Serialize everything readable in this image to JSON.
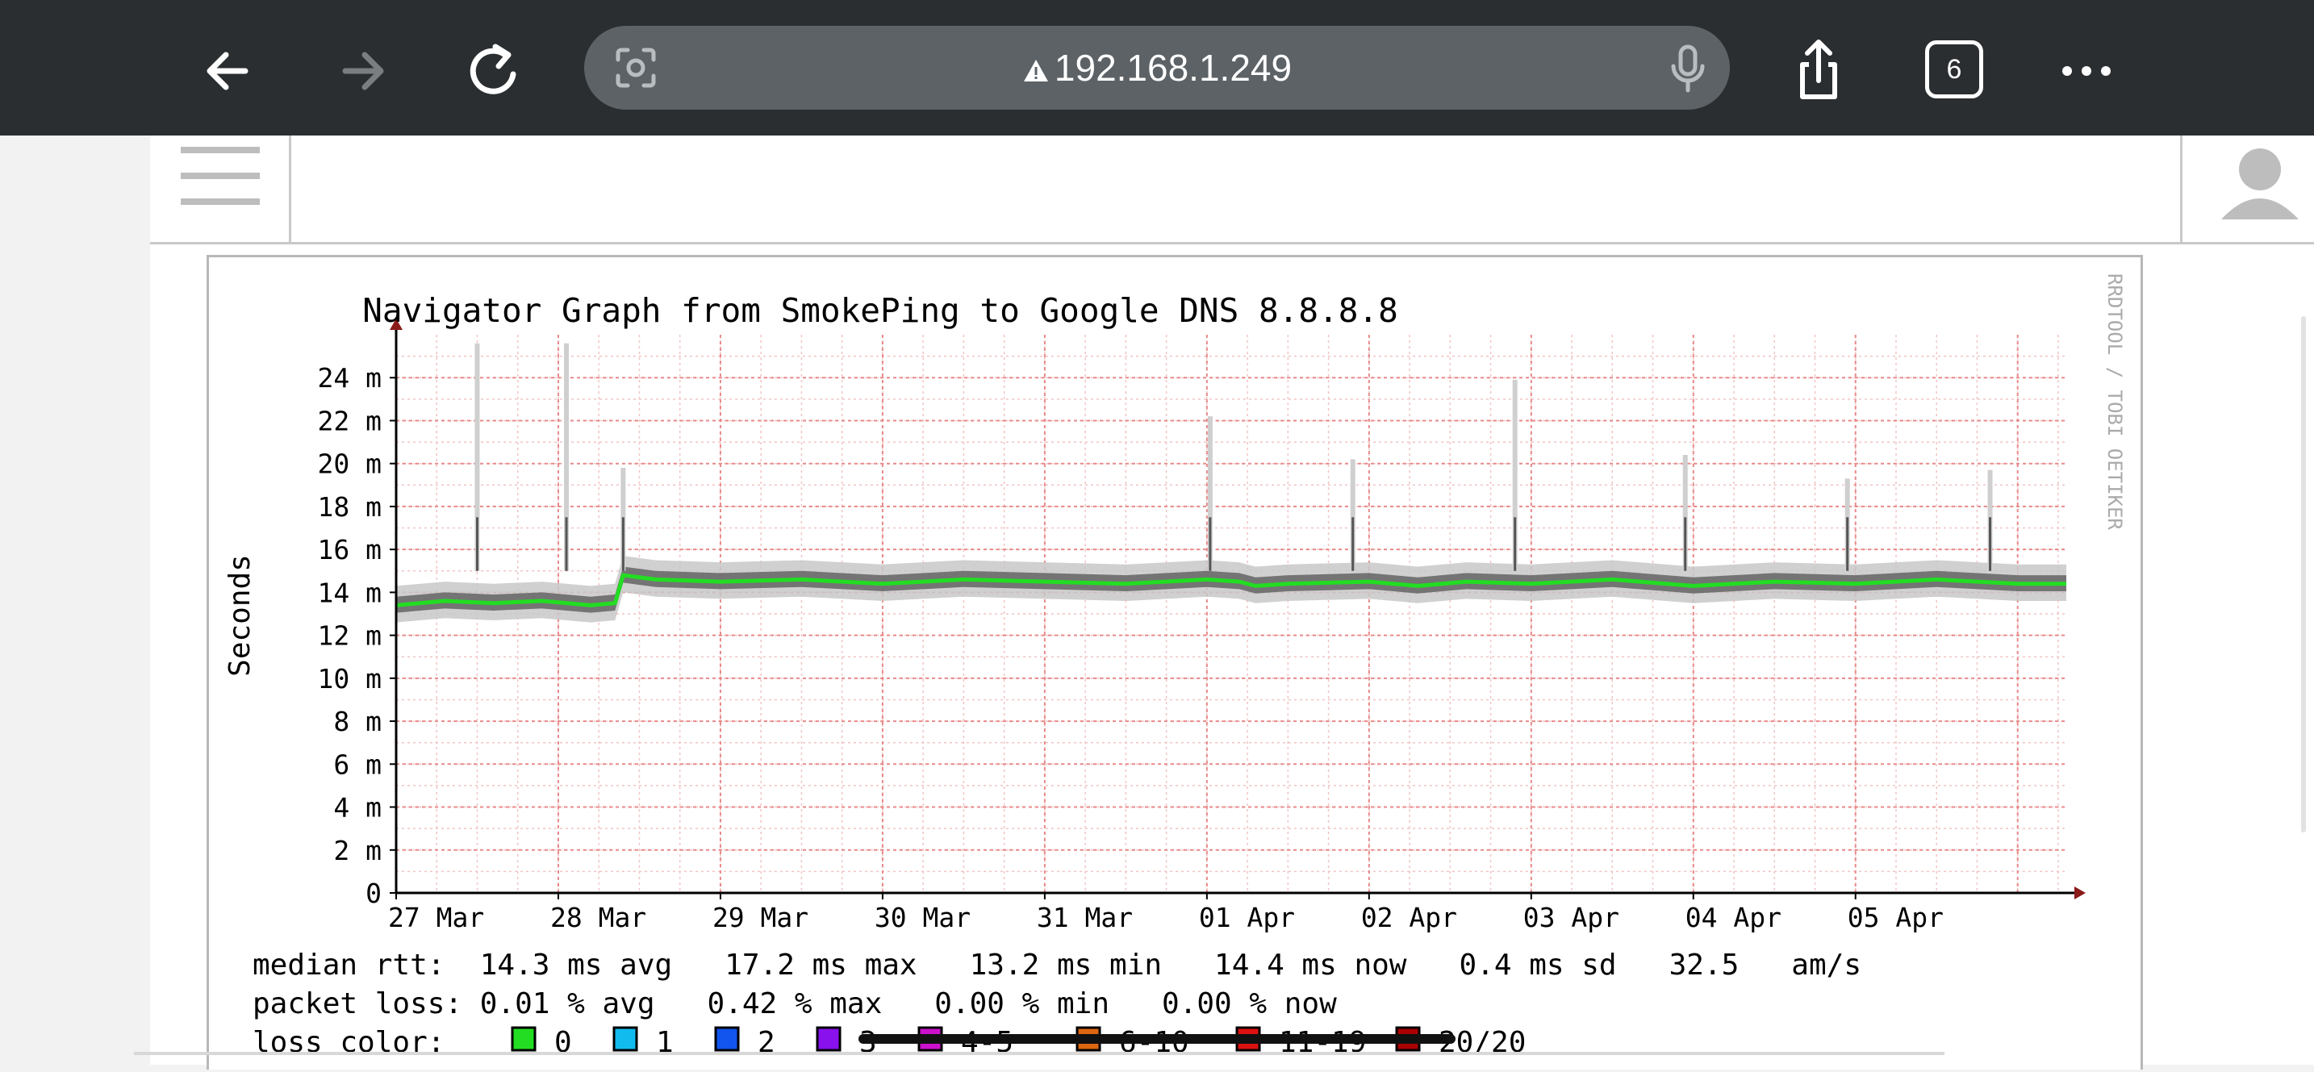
{
  "browser": {
    "url": "192.168.1.249",
    "tab_count": "6",
    "icons": [
      "back-arrow-icon",
      "forward-arrow-icon",
      "reload-icon",
      "page-lens-icon",
      "warning-icon",
      "microphone-icon",
      "share-icon",
      "tabs-icon",
      "more-icon"
    ]
  },
  "page": {
    "icons": [
      "hamburger-menu-icon",
      "user-avatar-icon"
    ]
  },
  "graph": {
    "watermark": "RRDTOOL / TOBI OETIKER",
    "stats": [
      "median rtt:  14.3 ms avg   17.2 ms max   13.2 ms min   14.4 ms now   0.4 ms sd   32.5   am/s",
      "packet loss: 0.01 % avg   0.42 % max   0.00 % min   0.00 % now"
    ],
    "legend_label": "loss color:",
    "legend": [
      {
        "label": "0",
        "color": "#22dd22"
      },
      {
        "label": "1",
        "color": "#11bbee"
      },
      {
        "label": "2",
        "color": "#1155ee"
      },
      {
        "label": "3",
        "color": "#8811ee"
      },
      {
        "label": "4-5",
        "color": "#cc11cc"
      },
      {
        "label": "6-10",
        "color": "#dd6611"
      },
      {
        "label": "11-19",
        "color": "#dd1111"
      },
      {
        "label": "20/20",
        "color": "#aa0000"
      }
    ]
  },
  "chart_data": {
    "type": "line",
    "title": "Navigator Graph from SmokePing to Google DNS 8.8.8.8",
    "ylabel": "Seconds",
    "xlabel": "",
    "ylim": [
      0,
      26
    ],
    "yticks": [
      0,
      2,
      4,
      6,
      8,
      10,
      12,
      14,
      16,
      18,
      20,
      22,
      24
    ],
    "ytick_labels": [
      "0",
      "2 m",
      "4 m",
      "6 m",
      "8 m",
      "10 m",
      "12 m",
      "14 m",
      "16 m",
      "18 m",
      "20 m",
      "22 m",
      "24 m"
    ],
    "xticks": [
      "27 Mar",
      "28 Mar",
      "29 Mar",
      "30 Mar",
      "31 Mar",
      "01 Apr",
      "02 Apr",
      "03 Apr",
      "04 Apr",
      "05 Apr"
    ],
    "xlim_days": [
      0,
      10.3
    ],
    "grid": true,
    "series": [
      {
        "name": "median rtt",
        "color": "#22dd22",
        "x": [
          0,
          0.3,
          0.6,
          0.9,
          1.2,
          1.35,
          1.4,
          1.6,
          2.0,
          2.5,
          3.0,
          3.5,
          4.0,
          4.5,
          5.0,
          5.2,
          5.3,
          5.5,
          6.0,
          6.15,
          6.3,
          6.6,
          7.0,
          7.5,
          8.0,
          8.5,
          9.0,
          9.5,
          10.0,
          10.3
        ],
        "y": [
          13.4,
          13.6,
          13.5,
          13.6,
          13.4,
          13.5,
          14.8,
          14.6,
          14.5,
          14.6,
          14.4,
          14.6,
          14.5,
          14.4,
          14.6,
          14.5,
          14.3,
          14.4,
          14.5,
          14.4,
          14.3,
          14.5,
          14.4,
          14.6,
          14.3,
          14.5,
          14.4,
          14.6,
          14.4,
          14.4
        ]
      }
    ],
    "spikes": [
      {
        "x": 0.5,
        "y": 25.6
      },
      {
        "x": 1.05,
        "y": 25.6
      },
      {
        "x": 1.4,
        "y": 19.8
      },
      {
        "x": 5.02,
        "y": 22.2
      },
      {
        "x": 5.9,
        "y": 20.2
      },
      {
        "x": 6.9,
        "y": 23.9
      },
      {
        "x": 7.95,
        "y": 20.4
      },
      {
        "x": 8.95,
        "y": 19.3
      },
      {
        "x": 9.83,
        "y": 19.7
      }
    ]
  }
}
